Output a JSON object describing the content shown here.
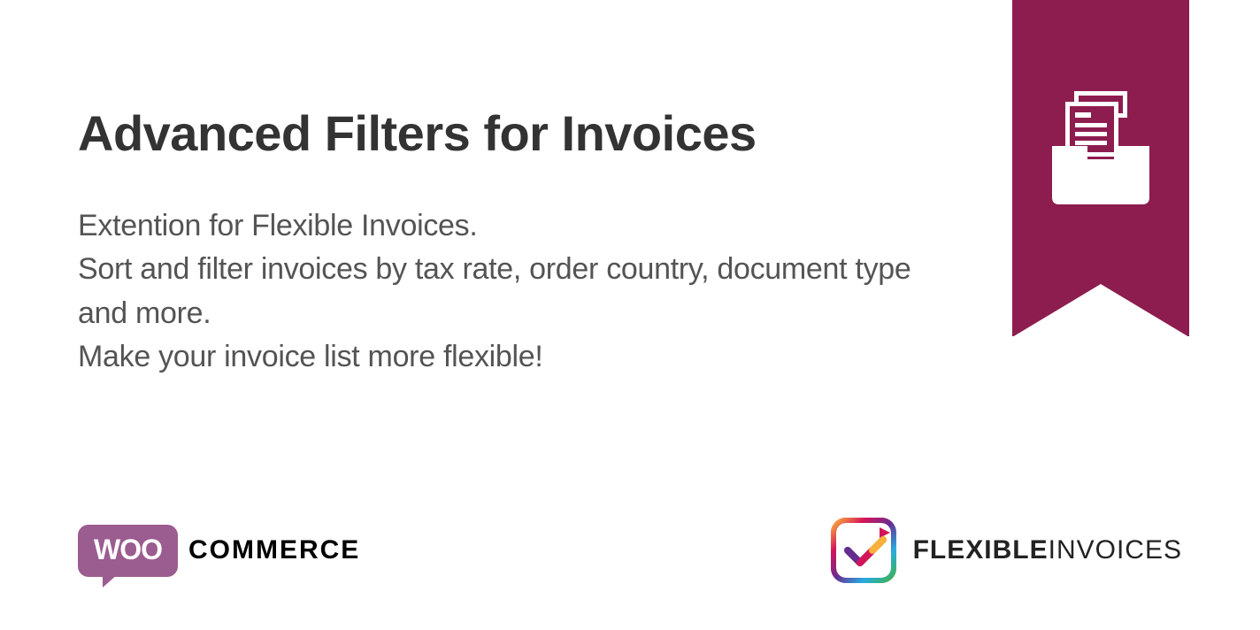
{
  "heading": "Advanced Filters for Invoices",
  "description_line1": "Extention for Flexible Invoices.",
  "description_line2": "Sort and filter invoices by tax rate, order country, document type and more.",
  "description_line3": "Make your invoice list more flexible!",
  "footer": {
    "woo_bubble": "WOO",
    "commerce": "COMMERCE",
    "flexible_bold": "FLEXIBLE",
    "flexible_light": "INVOICES"
  },
  "colors": {
    "ribbon": "#8d1d4f",
    "woo_purple": "#9b5c8f"
  }
}
